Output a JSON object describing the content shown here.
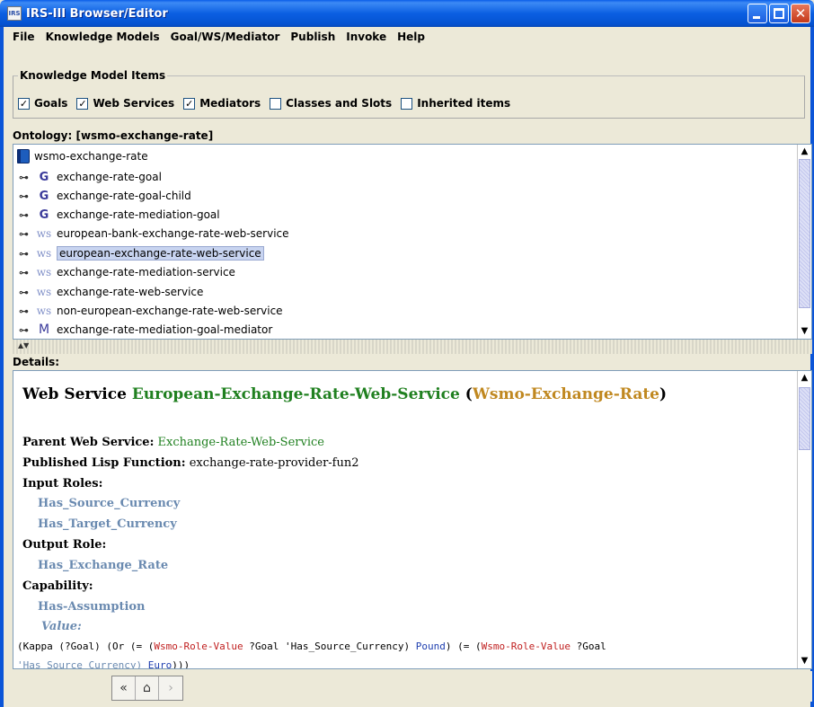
{
  "window": {
    "title": "IRS-III Browser/Editor",
    "app_icon_text": "IRS"
  },
  "menu": [
    "File",
    "Knowledge Models",
    "Goal/WS/Mediator",
    "Publish",
    "Invoke",
    "Help"
  ],
  "km_items": {
    "legend": "Knowledge Model Items",
    "checkboxes": [
      {
        "label": "Goals",
        "checked": true
      },
      {
        "label": "Web Services",
        "checked": true
      },
      {
        "label": "Mediators",
        "checked": true
      },
      {
        "label": "Classes and Slots",
        "checked": false
      },
      {
        "label": "Inherited items",
        "checked": false
      }
    ]
  },
  "ontology": {
    "header": "Ontology: [wsmo-exchange-rate]",
    "root": "wsmo-exchange-rate",
    "items": [
      {
        "type": "G",
        "label": "exchange-rate-goal",
        "selected": false
      },
      {
        "type": "G",
        "label": "exchange-rate-goal-child",
        "selected": false
      },
      {
        "type": "G",
        "label": "exchange-rate-mediation-goal",
        "selected": false
      },
      {
        "type": "WS",
        "label": "european-bank-exchange-rate-web-service",
        "selected": false
      },
      {
        "type": "WS",
        "label": "european-exchange-rate-web-service",
        "selected": true
      },
      {
        "type": "WS",
        "label": "exchange-rate-mediation-service",
        "selected": false
      },
      {
        "type": "WS",
        "label": "exchange-rate-web-service",
        "selected": false
      },
      {
        "type": "WS",
        "label": "non-european-exchange-rate-web-service",
        "selected": false
      },
      {
        "type": "M",
        "label": "exchange-rate-mediation-goal-mediator",
        "selected": false
      }
    ]
  },
  "details": {
    "header": "Details:",
    "title_prefix": "Web Service ",
    "title_name": "European-Exchange-Rate-Web-Service",
    "title_open": " (",
    "title_ontology": "Wsmo-Exchange-Rate",
    "title_close": ")",
    "parent_label": "Parent Web Service:",
    "parent_value": "Exchange-Rate-Web-Service",
    "lisp_label": "Published Lisp Function:",
    "lisp_value": "exchange-rate-provider-fun2",
    "input_roles_label": "Input Roles:",
    "input_roles": [
      "Has_Source_Currency",
      "Has_Target_Currency"
    ],
    "output_role_label": "Output Role:",
    "output_role": "Has_Exchange_Rate",
    "capability_label": "Capability:",
    "assumption": "Has-Assumption",
    "value_label": "Value:",
    "code_line1": {
      "a": "(Kappa (?Goal) (Or (= (",
      "b": "Wsmo-Role-Value",
      "c": " ?Goal 'Has_Source_Currency) ",
      "d": "Pound",
      "e": ") (= (",
      "f": "Wsmo-Role-Value",
      "g": " ?Goal"
    },
    "code_line2": {
      "a": "'Has_Source_Currency) ",
      "b": "Euro",
      "c": ")))"
    }
  },
  "colors": {
    "title_bar": "#0b5fe2",
    "name_green": "#208020",
    "ontology_gold": "#c08820",
    "role_blue": "#6a8ab0",
    "selection": "#c8d4f0"
  },
  "nav": {
    "back_icon": "«",
    "home_icon": "⌂",
    "forward_icon": "›"
  }
}
